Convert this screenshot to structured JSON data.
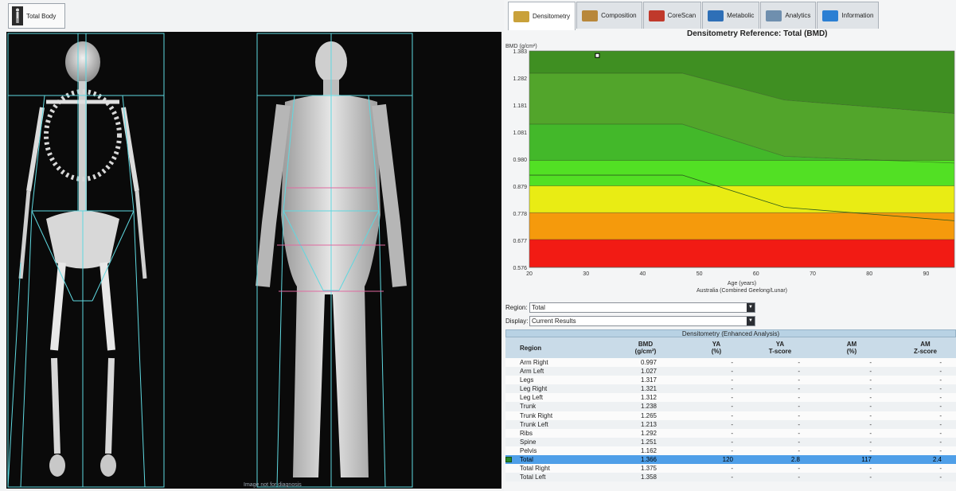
{
  "left_panel": {
    "tab_label": "Total Body",
    "disclaimer": "Image not for diagnosis"
  },
  "tabs": [
    {
      "label": "Densitometry",
      "active": true,
      "color": "#c9a13a"
    },
    {
      "label": "Composition",
      "active": false,
      "color": "#b8873a"
    },
    {
      "label": "CoreScan",
      "active": false,
      "color": "#c0392b"
    },
    {
      "label": "Metabolic",
      "active": false,
      "color": "#2e6fb7"
    },
    {
      "label": "Analytics",
      "active": false,
      "color": "#6f8fae"
    },
    {
      "label": "Information",
      "active": false,
      "color": "#2b7fd3"
    }
  ],
  "chart_data": {
    "type": "area",
    "title": "Densitometry Reference: Total (BMD)",
    "ylabel": "BMD (g/cm²)",
    "xlabel": "Age (years)",
    "subtitle": "Australia (Combined Geelong/Lunar)",
    "xlim": [
      20,
      95
    ],
    "ylim": [
      0.576,
      1.383
    ],
    "x_ticks": [
      20,
      30,
      40,
      50,
      60,
      70,
      80,
      90
    ],
    "y_ticks": [
      "1.383",
      "1.282",
      "1.181",
      "1.081",
      "0.980",
      "0.879",
      "0.778",
      "0.677",
      "0.576"
    ],
    "bands": [
      {
        "name": "top",
        "color": "#3f8f22",
        "upper": [
          [
            20,
            1.383
          ],
          [
            95,
            1.383
          ]
        ],
        "lower": [
          [
            20,
            1.3
          ],
          [
            47,
            1.3
          ],
          [
            65,
            1.2
          ],
          [
            95,
            1.15
          ]
        ]
      },
      {
        "name": "mid-green",
        "color": "#52a52b",
        "upper": [
          [
            20,
            1.3
          ],
          [
            47,
            1.3
          ],
          [
            65,
            1.2
          ],
          [
            95,
            1.15
          ]
        ],
        "lower": [
          [
            20,
            1.11
          ],
          [
            47,
            1.11
          ],
          [
            65,
            0.99
          ],
          [
            95,
            0.965
          ]
        ]
      },
      {
        "name": "green",
        "color": "#43b82a",
        "upper": [
          [
            20,
            1.11
          ],
          [
            47,
            1.11
          ],
          [
            65,
            0.99
          ],
          [
            95,
            0.965
          ]
        ],
        "lower": [
          [
            20,
            0.975
          ],
          [
            95,
            0.975
          ]
        ]
      },
      {
        "name": "bright-green",
        "color": "#52e024",
        "upper": [
          [
            20,
            0.975
          ],
          [
            95,
            0.975
          ]
        ],
        "lower": [
          [
            20,
            0.88
          ],
          [
            95,
            0.88
          ]
        ]
      },
      {
        "name": "yellow",
        "color": "#e9ec14",
        "upper": [
          [
            20,
            0.88
          ],
          [
            95,
            0.88
          ]
        ],
        "lower": [
          [
            20,
            0.78
          ],
          [
            95,
            0.78
          ]
        ]
      },
      {
        "name": "orange",
        "color": "#f59a0c",
        "upper": [
          [
            20,
            0.78
          ],
          [
            95,
            0.78
          ]
        ],
        "lower": [
          [
            20,
            0.68
          ],
          [
            95,
            0.68
          ]
        ]
      },
      {
        "name": "red",
        "color": "#f21b14",
        "upper": [
          [
            20,
            0.68
          ],
          [
            95,
            0.68
          ]
        ],
        "lower": [
          [
            20,
            0.576
          ],
          [
            95,
            0.576
          ]
        ]
      }
    ],
    "lines": [
      {
        "name": "line-a",
        "color": "#2c5a1c",
        "points": [
          [
            20,
            0.92
          ],
          [
            47,
            0.92
          ],
          [
            65,
            0.8
          ],
          [
            95,
            0.75
          ]
        ]
      }
    ],
    "marker": {
      "x": 32,
      "y": 1.366
    }
  },
  "filters": {
    "region_label": "Region:",
    "region_value": "Total",
    "display_label": "Display:",
    "display_value": "Current Results"
  },
  "table": {
    "caption": "Densitometry (Enhanced Analysis)",
    "headers": {
      "region": "Region",
      "bmd": "BMD",
      "bmd_unit": "(g/cm²)",
      "ya_pct": "YA",
      "ya_pct_sub": "(%)",
      "ya_t": "YA",
      "ya_t_sub": "T-score",
      "am_pct": "AM",
      "am_pct_sub": "(%)",
      "am_z": "AM",
      "am_z_sub": "Z-score"
    },
    "rows": [
      {
        "region": "Arm Right",
        "bmd": "0.997",
        "ya_pct": "-",
        "ya_t": "-",
        "am_pct": "-",
        "am_z": "-",
        "highlight": false
      },
      {
        "region": "Arm Left",
        "bmd": "1.027",
        "ya_pct": "-",
        "ya_t": "-",
        "am_pct": "-",
        "am_z": "-",
        "highlight": false
      },
      {
        "region": "Legs",
        "bmd": "1.317",
        "ya_pct": "-",
        "ya_t": "-",
        "am_pct": "-",
        "am_z": "-",
        "highlight": false
      },
      {
        "region": "Leg Right",
        "bmd": "1.321",
        "ya_pct": "-",
        "ya_t": "-",
        "am_pct": "-",
        "am_z": "-",
        "highlight": false
      },
      {
        "region": "Leg Left",
        "bmd": "1.312",
        "ya_pct": "-",
        "ya_t": "-",
        "am_pct": "-",
        "am_z": "-",
        "highlight": false
      },
      {
        "region": "Trunk",
        "bmd": "1.238",
        "ya_pct": "-",
        "ya_t": "-",
        "am_pct": "-",
        "am_z": "-",
        "highlight": false
      },
      {
        "region": "Trunk Right",
        "bmd": "1.265",
        "ya_pct": "-",
        "ya_t": "-",
        "am_pct": "-",
        "am_z": "-",
        "highlight": false
      },
      {
        "region": "Trunk Left",
        "bmd": "1.213",
        "ya_pct": "-",
        "ya_t": "-",
        "am_pct": "-",
        "am_z": "-",
        "highlight": false
      },
      {
        "region": "Ribs",
        "bmd": "1.292",
        "ya_pct": "-",
        "ya_t": "-",
        "am_pct": "-",
        "am_z": "-",
        "highlight": false
      },
      {
        "region": "Spine",
        "bmd": "1.251",
        "ya_pct": "-",
        "ya_t": "-",
        "am_pct": "-",
        "am_z": "-",
        "highlight": false
      },
      {
        "region": "Pelvis",
        "bmd": "1.162",
        "ya_pct": "-",
        "ya_t": "-",
        "am_pct": "-",
        "am_z": "-",
        "highlight": false
      },
      {
        "region": "Total",
        "bmd": "1.366",
        "ya_pct": "120",
        "ya_t": "2.8",
        "am_pct": "117",
        "am_z": "2.4",
        "highlight": true
      },
      {
        "region": "Total Right",
        "bmd": "1.375",
        "ya_pct": "-",
        "ya_t": "-",
        "am_pct": "-",
        "am_z": "-",
        "highlight": false
      },
      {
        "region": "Total Left",
        "bmd": "1.358",
        "ya_pct": "-",
        "ya_t": "-",
        "am_pct": "-",
        "am_z": "-",
        "highlight": false
      }
    ]
  }
}
